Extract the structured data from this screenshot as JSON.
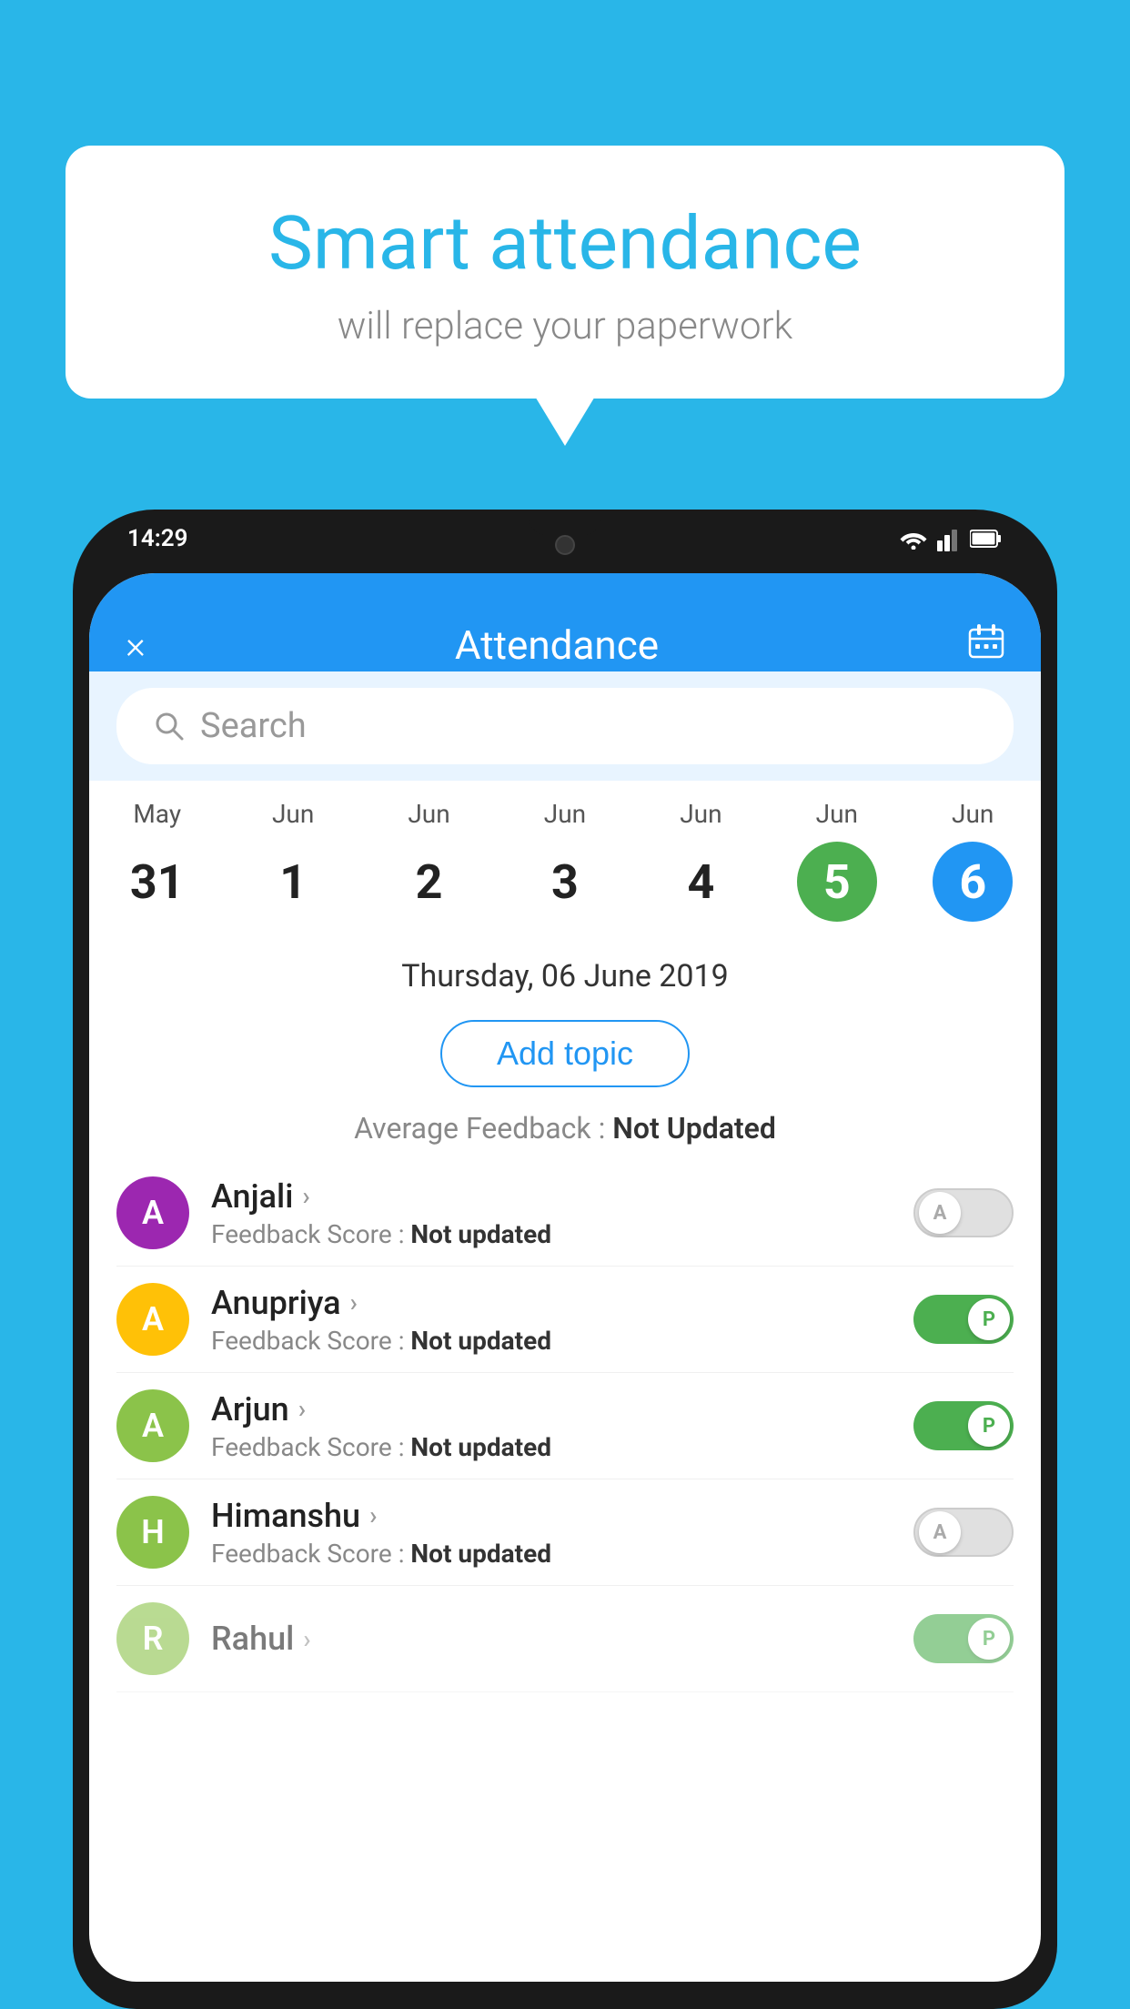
{
  "background_color": "#29B6E8",
  "bubble": {
    "title": "Smart attendance",
    "subtitle": "will replace your paperwork"
  },
  "status_bar": {
    "time": "14:29"
  },
  "header": {
    "title": "Attendance",
    "close_label": "×",
    "calendar_icon": "calendar"
  },
  "search": {
    "placeholder": "Search"
  },
  "calendar": {
    "days": [
      {
        "month": "May",
        "date": "31",
        "state": "normal"
      },
      {
        "month": "Jun",
        "date": "1",
        "state": "normal"
      },
      {
        "month": "Jun",
        "date": "2",
        "state": "normal"
      },
      {
        "month": "Jun",
        "date": "3",
        "state": "normal"
      },
      {
        "month": "Jun",
        "date": "4",
        "state": "normal"
      },
      {
        "month": "Jun",
        "date": "5",
        "state": "today"
      },
      {
        "month": "Jun",
        "date": "6",
        "state": "selected"
      }
    ]
  },
  "selected_date": "Thursday, 06 June 2019",
  "add_topic_label": "Add topic",
  "avg_feedback_label": "Average Feedback :",
  "avg_feedback_value": "Not Updated",
  "students": [
    {
      "name": "Anjali",
      "initial": "A",
      "avatar_color": "#9C27B0",
      "feedback_label": "Feedback Score :",
      "feedback_value": "Not updated",
      "toggle": "off",
      "toggle_letter": "A"
    },
    {
      "name": "Anupriya",
      "initial": "A",
      "avatar_color": "#FFC107",
      "feedback_label": "Feedback Score :",
      "feedback_value": "Not updated",
      "toggle": "on",
      "toggle_letter": "P"
    },
    {
      "name": "Arjun",
      "initial": "A",
      "avatar_color": "#8BC34A",
      "feedback_label": "Feedback Score :",
      "feedback_value": "Not updated",
      "toggle": "on",
      "toggle_letter": "P"
    },
    {
      "name": "Himanshu",
      "initial": "H",
      "avatar_color": "#8BC34A",
      "feedback_label": "Feedback Score :",
      "feedback_value": "Not updated",
      "toggle": "off",
      "toggle_letter": "A"
    }
  ]
}
